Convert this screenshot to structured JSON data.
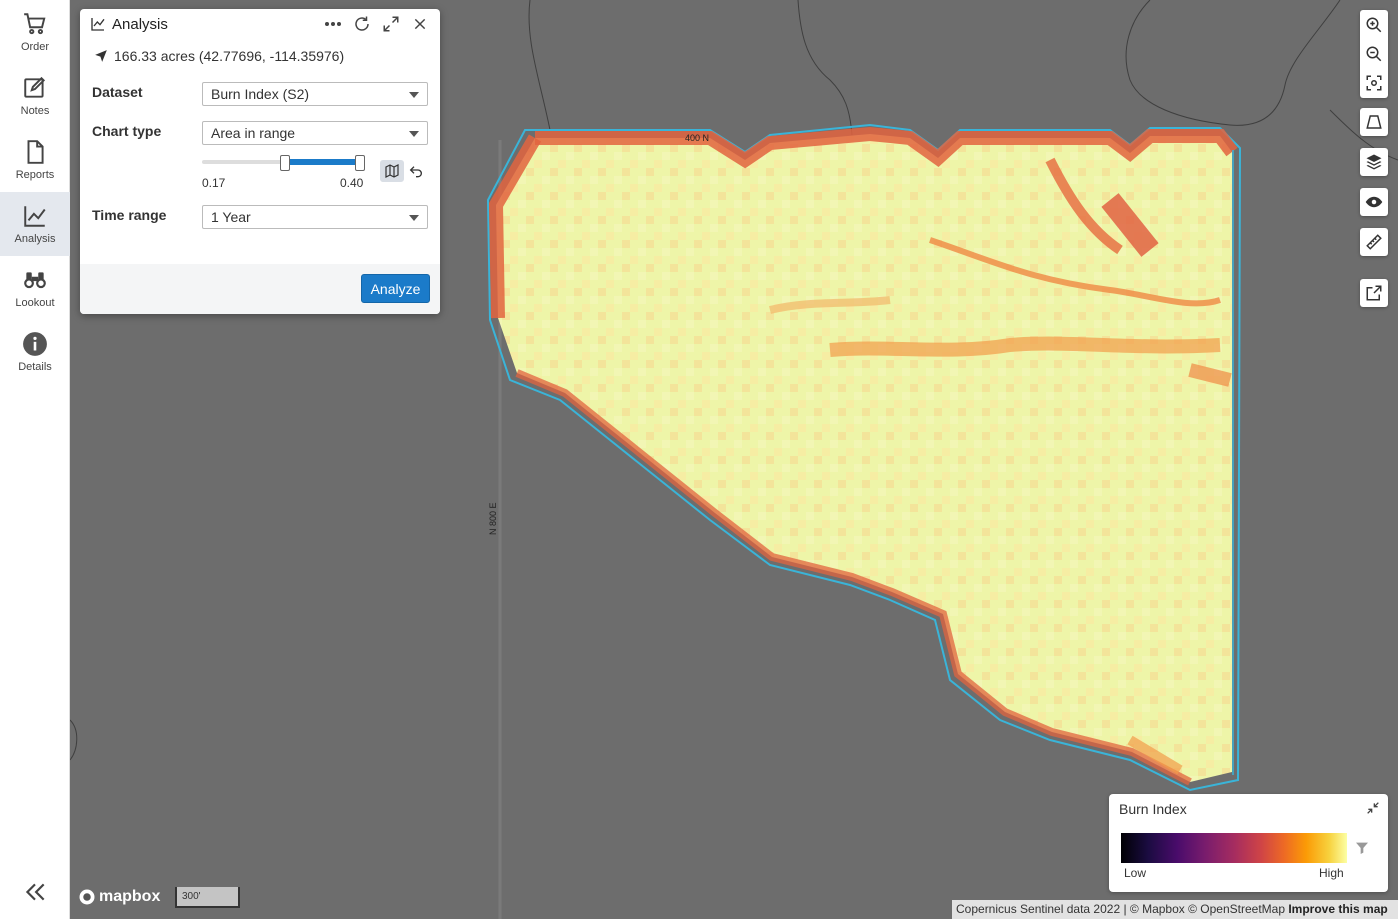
{
  "nav": {
    "items": [
      {
        "label": "Order",
        "icon": "cart-icon"
      },
      {
        "label": "Notes",
        "icon": "edit-icon"
      },
      {
        "label": "Reports",
        "icon": "document-icon"
      },
      {
        "label": "Analysis",
        "icon": "chart-line-icon",
        "active": true
      },
      {
        "label": "Lookout",
        "icon": "binoculars-icon"
      },
      {
        "label": "Details",
        "icon": "info-icon"
      }
    ],
    "collapse_icon": "double-chevron-left-icon"
  },
  "panel": {
    "title": "Analysis",
    "location": "166.33 acres (42.77696, -114.35976)",
    "dataset_label": "Dataset",
    "dataset_value": "Burn Index (S2)",
    "chart_type_label": "Chart type",
    "chart_type_value": "Area in range",
    "range_min": "0.17",
    "range_max": "0.40",
    "time_range_label": "Time range",
    "time_range_value": "1 Year",
    "analyze_label": "Analyze"
  },
  "map": {
    "road_label_top": "400 N",
    "road_label_side": "N 800 E",
    "scale_label": "300'",
    "logo": "mapbox",
    "attribution": "Copernicus Sentinel data 2022 | © Mapbox © OpenStreetMap",
    "attribution_link": "Improve this map"
  },
  "legend": {
    "title": "Burn Index",
    "low": "Low",
    "high": "High"
  },
  "colors": {
    "accent": "#1b7bc9",
    "boundary": "#3ab4d8",
    "burn_low": "#e8f3a8",
    "burn_high": "#e0503a"
  }
}
